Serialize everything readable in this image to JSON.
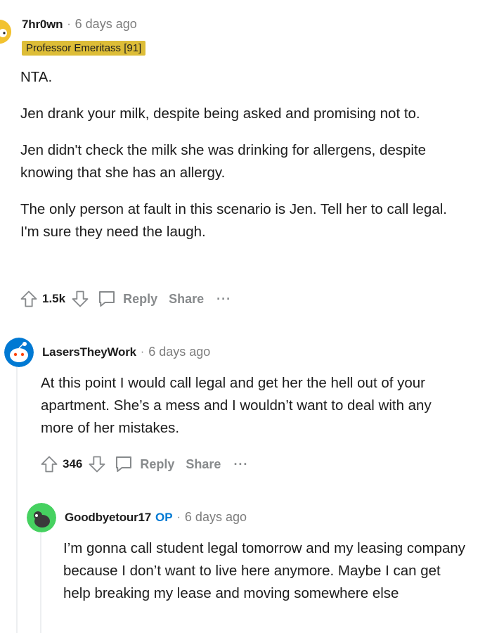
{
  "comments": [
    {
      "username": "7hr0wn",
      "time": "6 days ago",
      "flair": "Professor Emeritass [91]",
      "paragraphs": [
        "NTA.",
        "Jen drank your milk, despite being asked and promising not to.",
        "Jen didn't check the milk she was drinking for allergens, despite knowing that she has an allergy.",
        "The only person at fault in this scenario is Jen. Tell her to call legal. I'm sure they need the laugh."
      ],
      "score": "1.5k",
      "reply_label": "Reply",
      "share_label": "Share",
      "more_label": "···"
    },
    {
      "username": "LasersTheyWork",
      "time": "6 days ago",
      "paragraphs": [
        "At this point I would call legal and get her the hell out of your apartment. She’s a mess and I wouldn’t want to deal with any more of her mistakes."
      ],
      "score": "346",
      "reply_label": "Reply",
      "share_label": "Share",
      "more_label": "···"
    },
    {
      "username": "Goodbyetour17",
      "op_badge": "OP",
      "time": "6 days ago",
      "paragraphs": [
        "I’m gonna call student legal tomorrow and my leasing company because I don’t want to live here anymore. Maybe I can get help breaking my lease and moving somewhere else"
      ]
    }
  ],
  "separator": "·",
  "colors": {
    "flair_bg": "#ddbd37",
    "op_blue": "#0079d3",
    "muted": "#878a8c",
    "avatar_blue": "#0079d3",
    "avatar_green": "#46d160"
  }
}
